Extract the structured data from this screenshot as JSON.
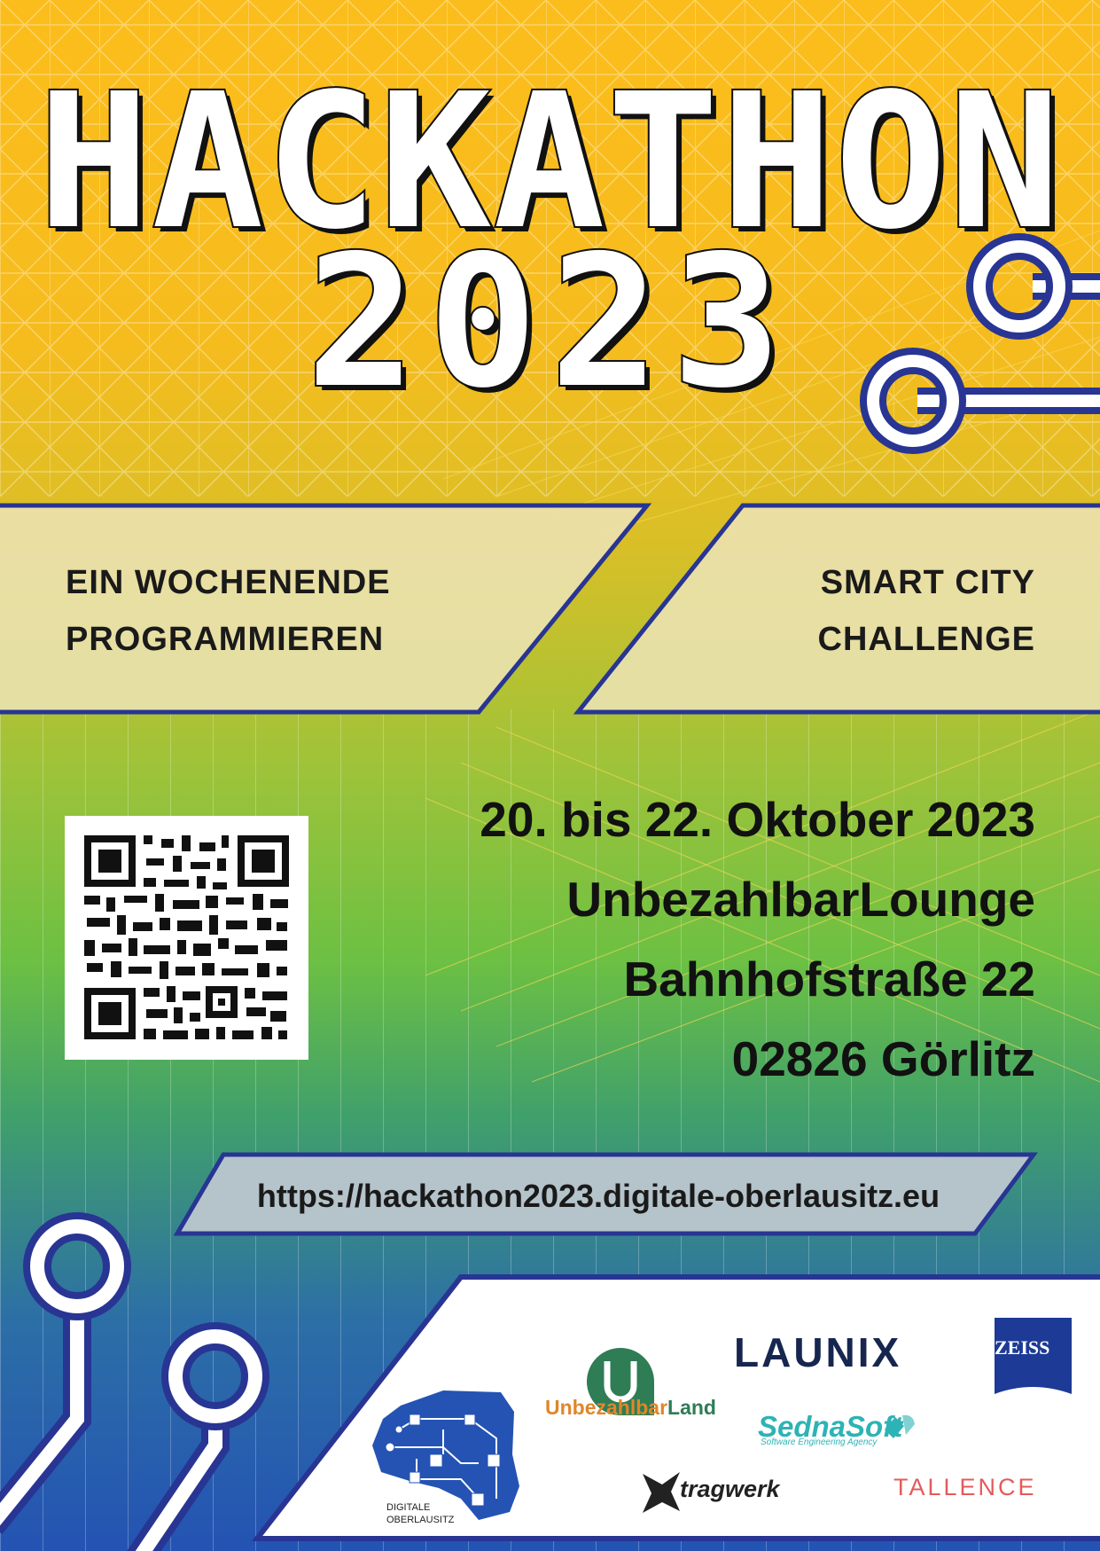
{
  "title": {
    "line1": "HACKATHON",
    "line2": "2023"
  },
  "band_left": {
    "line1": "EIN WOCHENENDE",
    "line2": "PROGRAMMIEREN"
  },
  "band_right": {
    "line1": "SMART CITY",
    "line2": "CHALLENGE"
  },
  "event": {
    "date": "20. bis 22. Oktober 2023",
    "venue": "UnbezahlbarLounge",
    "street": "Bahnhofstraße 22",
    "city": "02826 Görlitz"
  },
  "url": "https://hackathon2023.digitale-oberlausitz.eu",
  "sponsors": {
    "launix": "LAUNIX",
    "unbezahlbar_part1": "Unbezahlbar",
    "unbezahlbar_part2": "Land",
    "unbezahlbar_icon": "u-icon",
    "sedna": "SednaSoft",
    "sedna_sub": "Software Engineering Agency",
    "tragwerk": "tragwerk",
    "tallence": "TALLENCE",
    "zeiss": "ZEISS",
    "digitale_oberlausitz": [
      "DIGITALE",
      "OBERLAUSITZ"
    ]
  },
  "colors": {
    "accent_navy": "#283593",
    "band_fill": "#ece3b4",
    "url_fill": "#b5c3cb",
    "yellow": "#fbbd1c",
    "green": "#6cc043",
    "blue": "#2453b3"
  }
}
